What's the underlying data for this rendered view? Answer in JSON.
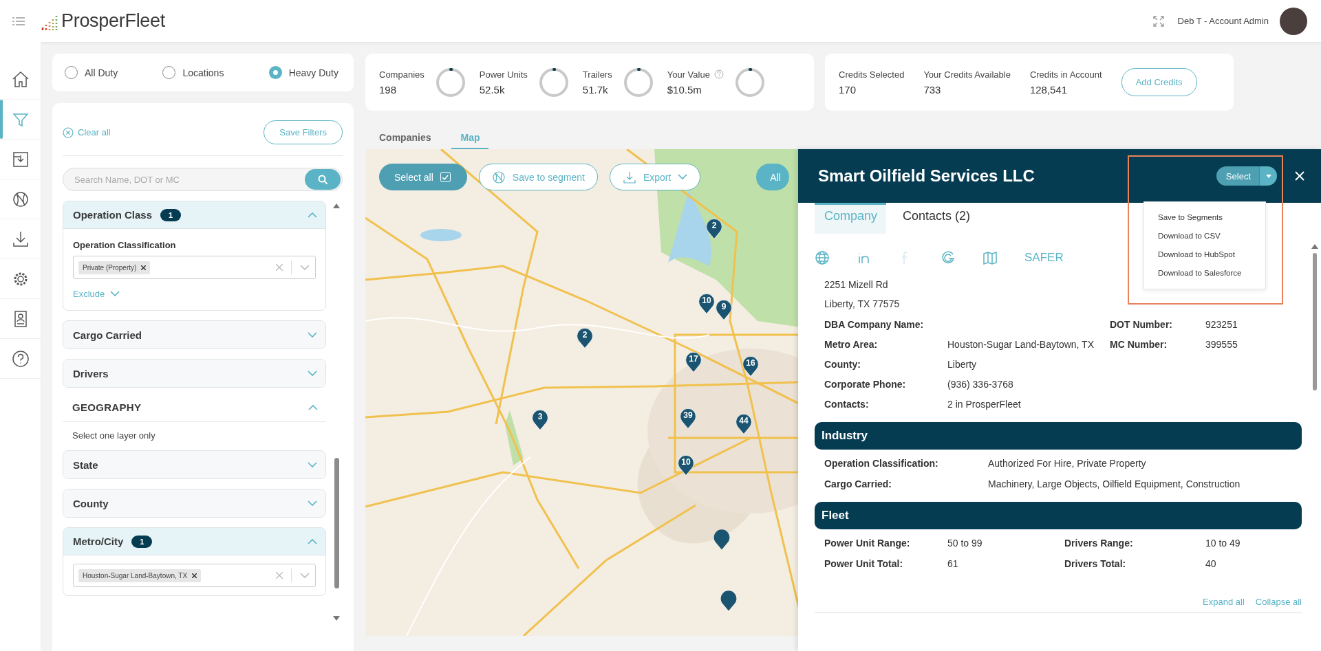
{
  "header": {
    "logo": "ProsperFleet",
    "user": "Deb T - Account Admin"
  },
  "rail": [
    {
      "kind": "home",
      "selected": false
    },
    {
      "kind": "filter",
      "selected": true
    },
    {
      "kind": "inbox",
      "selected": false
    },
    {
      "kind": "ball",
      "selected": false
    },
    {
      "kind": "download",
      "selected": false
    },
    {
      "kind": "gear",
      "selected": false
    },
    {
      "kind": "contact",
      "selected": false
    },
    {
      "kind": "help",
      "selected": false
    }
  ],
  "duty": [
    {
      "label": "All Duty",
      "selected": false
    },
    {
      "label": "Locations",
      "selected": false
    },
    {
      "label": "Heavy Duty",
      "selected": true
    }
  ],
  "filters": {
    "clear": "Clear all",
    "save": "Save Filters",
    "search": {
      "placeholder": "Search Name, DOT or MC"
    },
    "sections": [
      {
        "kind": "group",
        "title": "Operation Class",
        "badge": "1",
        "expanded": true,
        "field_label": "Operation Classification",
        "chips": [
          "Private (Property)"
        ],
        "exclude": "Exclude"
      },
      {
        "kind": "group",
        "title": "Cargo Carried",
        "expanded": false
      },
      {
        "kind": "group",
        "title": "Drivers",
        "expanded": false
      },
      {
        "kind": "heading",
        "title": "GEOGRAPHY",
        "expanded": true,
        "note": "Select one layer only"
      },
      {
        "kind": "group",
        "title": "State",
        "expanded": false
      },
      {
        "kind": "group",
        "title": "County",
        "expanded": false
      },
      {
        "kind": "group",
        "title": "Metro/City",
        "badge": "1",
        "expanded": true,
        "chips": [
          "Houston-Sugar Land-Baytown, TX"
        ]
      }
    ]
  },
  "stats": [
    {
      "label": "Companies",
      "value": "198",
      "level": 0.01
    },
    {
      "label": "Power Units",
      "value": "52.5k",
      "level": 0.01
    },
    {
      "label": "Trailers",
      "value": "51.7k",
      "level": 0.01
    },
    {
      "label": "Your Value",
      "value": "$10.5m",
      "level": 0.01,
      "info": true
    }
  ],
  "credits": {
    "items": [
      {
        "label": "Credits Selected",
        "value": "170"
      },
      {
        "label": "Your Credits Available",
        "value": "733"
      },
      {
        "label": "Credits in Account",
        "value": "128,541"
      }
    ],
    "button": "Add Credits"
  },
  "view_tabs": [
    {
      "label": "Companies",
      "selected": false
    },
    {
      "label": "Map",
      "selected": true
    }
  ],
  "map": {
    "select_all": {
      "label": "Select all",
      "checked": true
    },
    "save_segment": "Save to segment",
    "export": "Export",
    "filter_all": "All",
    "markers": [
      {
        "label": "2"
      },
      {
        "label": "10"
      },
      {
        "label": "9"
      },
      {
        "label": "2"
      },
      {
        "label": "17"
      },
      {
        "label": "16"
      },
      {
        "label": "3"
      },
      {
        "label": "39"
      },
      {
        "label": "44"
      },
      {
        "label": "10"
      },
      {
        "kind": "plain"
      },
      {
        "kind": "plain"
      }
    ]
  },
  "detail": {
    "title": "Smart Oilfield Services LLC",
    "select": "Select",
    "menu": [
      "Save to Segments",
      "Download to CSV",
      "Download to HubSpot",
      "Download to Salesforce"
    ],
    "tabs": [
      {
        "label": "Company",
        "selected": true
      },
      {
        "label": "Contacts (2)",
        "selected": false
      }
    ],
    "links": [
      {
        "kind": "globe",
        "disabled": false
      },
      {
        "kind": "linkedin",
        "disabled": false
      },
      {
        "kind": "facebook",
        "disabled": true
      },
      {
        "kind": "google",
        "disabled": false
      },
      {
        "kind": "map",
        "disabled": false
      }
    ],
    "safer": "SAFER",
    "address": [
      "2251 Mizell Rd",
      "Liberty, TX 77575"
    ],
    "fields": [
      [
        {
          "label": "DBA Company Name:"
        },
        {
          "label": "DOT Number:",
          "value": "923251"
        }
      ],
      [
        {
          "label": "Metro Area:",
          "value": "Houston-Sugar Land-Baytown, TX"
        },
        {
          "label": "MC Number:",
          "value": "399555"
        }
      ],
      [
        {
          "label": "County:",
          "value": "Liberty"
        }
      ],
      [
        {
          "label": "Corporate Phone:",
          "value": "(936) 336-3768"
        }
      ],
      [
        {
          "label": "Contacts:",
          "value": "2 in ProsperFleet"
        }
      ]
    ],
    "sections": [
      {
        "title": "Industry",
        "kind": "wide",
        "rows": [
          [
            {
              "label": "Operation Classification:",
              "value": "Authorized For Hire, Private Property"
            }
          ],
          [
            {
              "label": "Cargo Carried:",
              "value": "Machinery, Large Objects, Oilfield Equipment, Construction"
            }
          ]
        ]
      },
      {
        "title": "Fleet",
        "kind": "pairs",
        "rows": [
          [
            {
              "label": "Power Unit Range:",
              "value": "50 to 99"
            },
            {
              "label": "Drivers Range:",
              "value": "10 to 49"
            }
          ],
          [
            {
              "label": "Power Unit Total:",
              "value": "61"
            },
            {
              "label": "Drivers Total:",
              "value": "40"
            }
          ]
        ]
      }
    ],
    "expand_all": "Expand all",
    "collapse_all": "Collapse all"
  }
}
